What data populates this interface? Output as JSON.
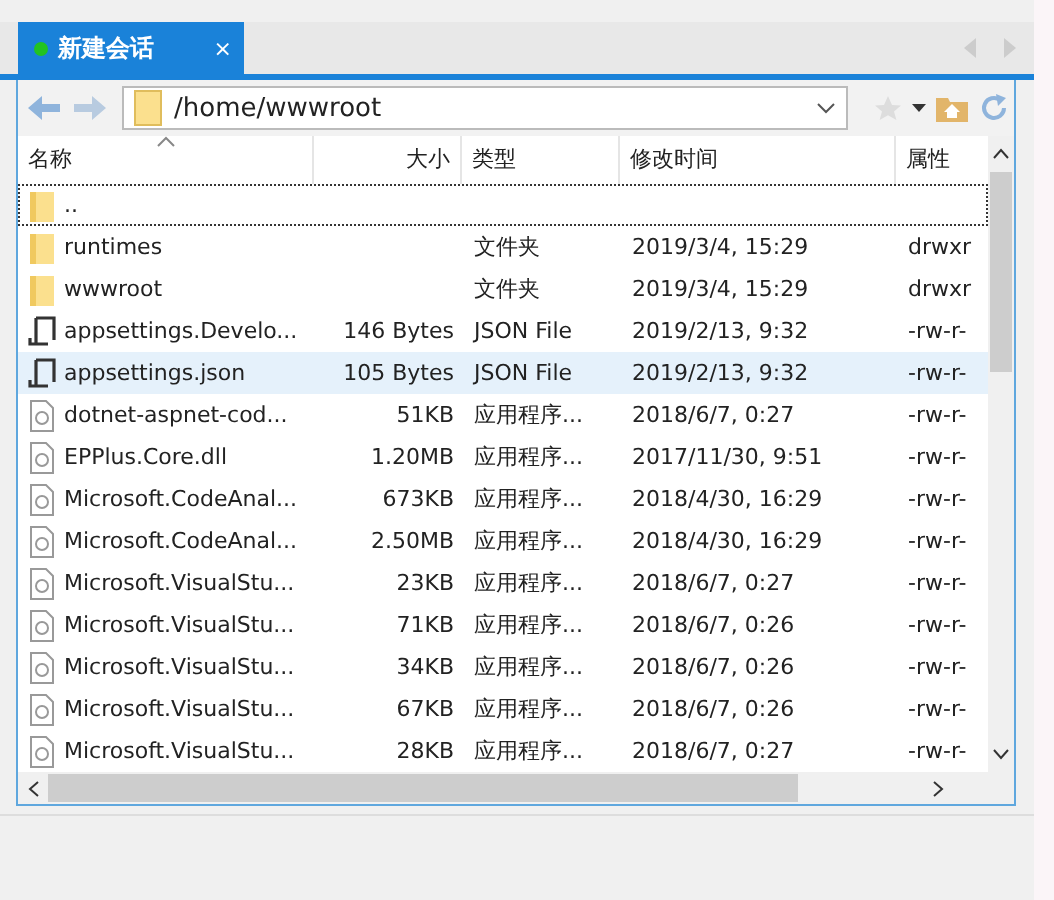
{
  "tabs": [
    {
      "label": "新建会话",
      "selected": true,
      "connected": true
    }
  ],
  "close_glyph": "×",
  "address": {
    "value": "/home/wwwroot"
  },
  "table": {
    "columns": [
      {
        "label": "名称",
        "sorted": true
      },
      {
        "label": "大小",
        "sorted": false
      },
      {
        "label": "类型",
        "sorted": false
      },
      {
        "label": "修改时间",
        "sorted": false
      },
      {
        "label": "属性",
        "sorted": false
      }
    ],
    "rows": [
      {
        "kind": "folder",
        "name": "..",
        "size": "",
        "type": "",
        "modified": "",
        "attributes": "",
        "selected": false,
        "focused": true
      },
      {
        "kind": "folder",
        "name": "runtimes",
        "size": "",
        "type": "文件夹",
        "modified": "2019/3/4, 15:29",
        "attributes": "drwxr",
        "selected": false,
        "focused": false
      },
      {
        "kind": "folder",
        "name": "wwwroot",
        "size": "",
        "type": "文件夹",
        "modified": "2019/3/4, 15:29",
        "attributes": "drwxr",
        "selected": false,
        "focused": false
      },
      {
        "kind": "script",
        "name": "appsettings.Develo...",
        "size": "146 Bytes",
        "type": "JSON File",
        "modified": "2019/2/13, 9:32",
        "attributes": "-rw-r-",
        "selected": false,
        "focused": false
      },
      {
        "kind": "script",
        "name": "appsettings.json",
        "size": "105 Bytes",
        "type": "JSON File",
        "modified": "2019/2/13, 9:32",
        "attributes": "-rw-r-",
        "selected": true,
        "focused": false
      },
      {
        "kind": "library",
        "name": "dotnet-aspnet-cod...",
        "size": "51KB",
        "type": "应用程序...",
        "modified": "2018/6/7, 0:27",
        "attributes": "-rw-r-",
        "selected": false,
        "focused": false
      },
      {
        "kind": "library",
        "name": "EPPlus.Core.dll",
        "size": "1.20MB",
        "type": "应用程序...",
        "modified": "2017/11/30, 9:51",
        "attributes": "-rw-r-",
        "selected": false,
        "focused": false
      },
      {
        "kind": "library",
        "name": "Microsoft.CodeAnal...",
        "size": "673KB",
        "type": "应用程序...",
        "modified": "2018/4/30, 16:29",
        "attributes": "-rw-r-",
        "selected": false,
        "focused": false
      },
      {
        "kind": "library",
        "name": "Microsoft.CodeAnal...",
        "size": "2.50MB",
        "type": "应用程序...",
        "modified": "2018/4/30, 16:29",
        "attributes": "-rw-r-",
        "selected": false,
        "focused": false
      },
      {
        "kind": "library",
        "name": "Microsoft.VisualStu...",
        "size": "23KB",
        "type": "应用程序...",
        "modified": "2018/6/7, 0:27",
        "attributes": "-rw-r-",
        "selected": false,
        "focused": false
      },
      {
        "kind": "library",
        "name": "Microsoft.VisualStu...",
        "size": "71KB",
        "type": "应用程序...",
        "modified": "2018/6/7, 0:26",
        "attributes": "-rw-r-",
        "selected": false,
        "focused": false
      },
      {
        "kind": "library",
        "name": "Microsoft.VisualStu...",
        "size": "34KB",
        "type": "应用程序...",
        "modified": "2018/6/7, 0:26",
        "attributes": "-rw-r-",
        "selected": false,
        "focused": false
      },
      {
        "kind": "library",
        "name": "Microsoft.VisualStu...",
        "size": "67KB",
        "type": "应用程序...",
        "modified": "2018/6/7, 0:26",
        "attributes": "-rw-r-",
        "selected": false,
        "focused": false
      },
      {
        "kind": "library",
        "name": "Microsoft.VisualStu...",
        "size": "28KB",
        "type": "应用程序...",
        "modified": "2018/6/7, 0:27",
        "attributes": "-rw-r-",
        "selected": false,
        "focused": false
      }
    ]
  }
}
